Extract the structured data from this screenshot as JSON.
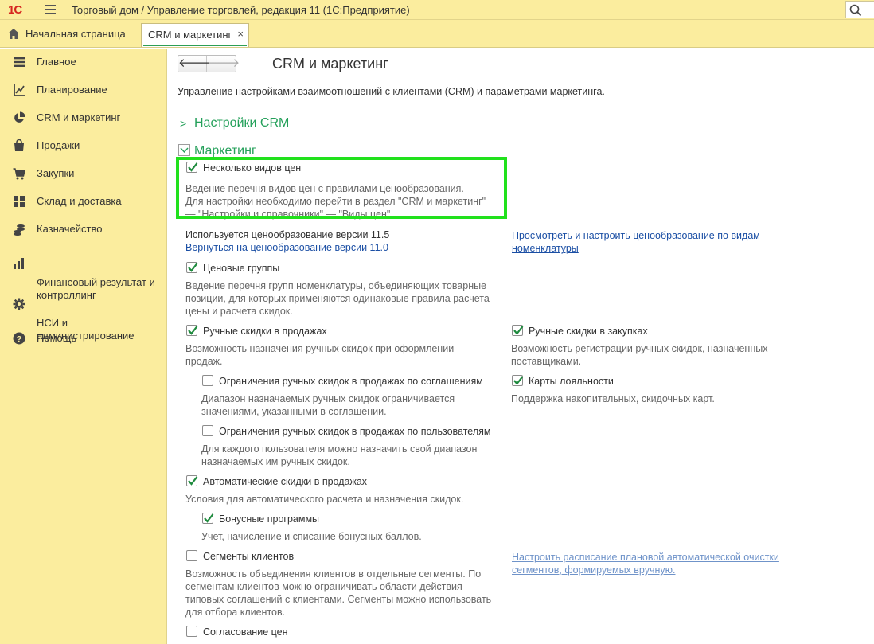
{
  "titlebar": {
    "logo": "1С",
    "title": "Торговый дом / Управление торговлей, редакция 11  (1С:Предприятие)"
  },
  "tabs": {
    "home": "Начальная страница",
    "active": "CRM и маркетинг",
    "close": "×"
  },
  "sidebar": {
    "items": [
      {
        "label": "Главное",
        "icon": "menu-lines-icon"
      },
      {
        "label": "Планирование",
        "icon": "planning-icon"
      },
      {
        "label": "CRM и маркетинг",
        "icon": "pie-chart-icon"
      },
      {
        "label": "Продажи",
        "icon": "shopping-bag-icon"
      },
      {
        "label": "Закупки",
        "icon": "cart-icon"
      },
      {
        "label": "Склад и доставка",
        "icon": "warehouse-icon"
      },
      {
        "label": "Казначейство",
        "icon": "coins-icon"
      },
      {
        "label": "Финансовый результат и\nконтроллинг",
        "icon": "bar-chart-icon"
      },
      {
        "label": "НСИ и\nадминистрирование",
        "icon": "gear-icon"
      },
      {
        "label": "Помощь",
        "icon": "help-icon"
      }
    ]
  },
  "page": {
    "title": "CRM и маркетинг",
    "subtitle": "Управление настройками взаимоотношений с клиентами (CRM) и параметрами маркетинга.",
    "section_crm": "Настройки CRM",
    "section_marketing": "Маркетинг"
  },
  "options": {
    "price_types": {
      "label": "Несколько видов цен",
      "checked": true,
      "desc": [
        "Ведение перечня видов цен с правилами ценообразования.",
        "Для настройки необходимо перейти в раздел \"CRM и маркетинг\"",
        "— \"Настройки и справочники\" — \"Виды цен\"."
      ]
    },
    "pricing_version": {
      "text": "Используется ценообразование версии 11.5",
      "link": "Вернуться на ценообразование версии 11.0"
    },
    "pricing_link": [
      "Просмотреть и настроить ценообразование по видам",
      "номенклатуры"
    ],
    "price_groups": {
      "label": "Ценовые группы",
      "checked": true,
      "desc": [
        "Ведение перечня групп номенклатуры, объединяющих товарные",
        "позиции, для которых применяются одинаковые правила расчета",
        "цены и расчета скидок."
      ]
    },
    "manual_sales": {
      "label": "Ручные скидки в продажах",
      "checked": true,
      "desc": [
        "Возможность назначения ручных скидок при оформлении",
        "продаж."
      ]
    },
    "manual_purchases": {
      "label": "Ручные скидки в закупках",
      "checked": true,
      "desc": [
        "Возможность регистрации ручных скидок, назначенных",
        "поставщиками."
      ]
    },
    "limit_agreements": {
      "label": "Ограничения ручных скидок в продажах по соглашениям",
      "checked": false,
      "desc": [
        "Диапазон назначаемых ручных скидок ограничивается",
        "значениями, указанными в соглашении."
      ]
    },
    "loyalty_cards": {
      "label": "Карты лояльности",
      "checked": true,
      "desc": [
        "Поддержка накопительных, скидочных карт."
      ]
    },
    "limit_users": {
      "label": "Ограничения ручных скидок в продажах по пользователям",
      "checked": false,
      "desc": [
        "Для каждого пользователя можно назначить свой диапазон",
        "назначаемых им ручных скидок."
      ]
    },
    "auto_discounts": {
      "label": "Автоматические скидки в продажах",
      "checked": true,
      "desc": [
        "Условия для автоматического расчета и назначения скидок."
      ]
    },
    "bonus": {
      "label": "Бонусные программы",
      "checked": true,
      "desc": [
        "Учет, начисление и списание бонусных баллов."
      ]
    },
    "segments": {
      "label": "Сегменты клиентов",
      "checked": false,
      "desc": [
        "Возможность объединения клиентов в отдельные сегменты. По",
        "сегментам клиентов можно ограничивать области действия",
        "типовых соглашений с клиентами. Сегменты можно использовать",
        "для отбора клиентов."
      ]
    },
    "segments_link": [
      "Настроить расписание плановой автоматической очистки",
      "сегментов, формируемых вручную."
    ],
    "price_approval": {
      "label": "Согласование цен",
      "checked": false
    }
  },
  "colors": {
    "accent_green": "#24a05a",
    "highlight": "#21e11c",
    "sidebar_bg": "#fbed9e",
    "link": "#1a4ea4"
  }
}
